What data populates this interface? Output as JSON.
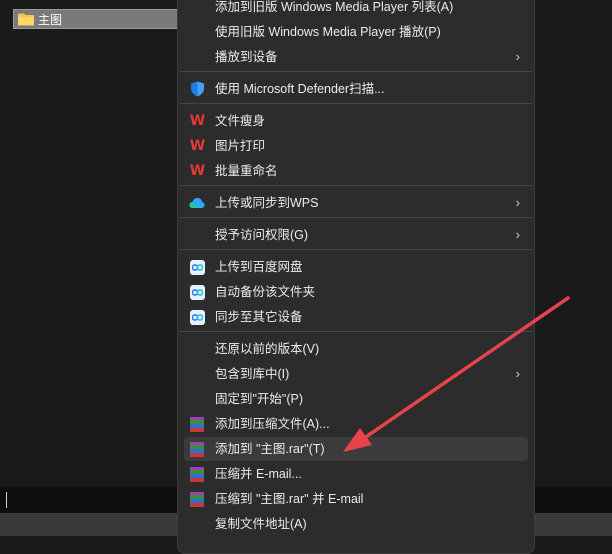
{
  "explorer": {
    "folder_name": "主图"
  },
  "menu": {
    "items": [
      {
        "label": "添加到旧版 Windows Media Player 列表(A)",
        "icon": "none"
      },
      {
        "label": "使用旧版 Windows Media Player 播放(P)",
        "icon": "none"
      },
      {
        "label": "播放到设备",
        "icon": "none",
        "submenu": "›"
      },
      {
        "label": "使用 Microsoft Defender扫描...",
        "icon": "defender-shield-icon"
      },
      {
        "label": "文件瘦身",
        "icon": "wps-icon",
        "glyph": "W"
      },
      {
        "label": "图片打印",
        "icon": "wps-icon",
        "glyph": "W"
      },
      {
        "label": "批量重命名",
        "icon": "wps-icon",
        "glyph": "W"
      },
      {
        "label": "上传或同步到WPS",
        "icon": "wps-cloud-icon",
        "submenu": "›"
      },
      {
        "label": "授予访问权限(G)",
        "icon": "none",
        "submenu": "›"
      },
      {
        "label": "上传到百度网盘",
        "icon": "baidu-netdisk-icon"
      },
      {
        "label": "自动备份该文件夹",
        "icon": "baidu-netdisk-icon"
      },
      {
        "label": "同步至其它设备",
        "icon": "baidu-netdisk-icon"
      },
      {
        "label": "还原以前的版本(V)",
        "icon": "none"
      },
      {
        "label": "包含到库中(I)",
        "icon": "none",
        "submenu": "›"
      },
      {
        "label": "固定到\"开始\"(P)",
        "icon": "none"
      },
      {
        "label": "添加到压缩文件(A)...",
        "icon": "winrar-icon"
      },
      {
        "label": "添加到 \"主图.rar\"(T)",
        "icon": "winrar-icon"
      },
      {
        "label": "压缩并 E-mail...",
        "icon": "winrar-icon"
      },
      {
        "label": "压缩到 \"主图.rar\" 并 E-mail",
        "icon": "winrar-icon"
      },
      {
        "label": "复制文件地址(A)",
        "icon": "none"
      }
    ]
  },
  "colors": {
    "menu_bg": "#2c2c2c",
    "annotation_arrow": "#e8434a",
    "wps_red": "#e53935"
  }
}
